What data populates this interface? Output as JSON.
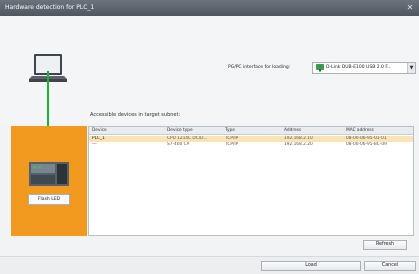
{
  "window": {
    "title": "Hardware detection for PLC_1",
    "close_glyph": "✕"
  },
  "interface": {
    "label": "PG/PC interface for loading:",
    "selected": "D-Link DUB-E100 USB 2.0 F...",
    "icon": "network-adapter-icon"
  },
  "table": {
    "caption": "Accessible devices in target subnet:",
    "headers": {
      "device": "Device",
      "device_type": "Device type",
      "type": "Type",
      "address": "Address",
      "mac": "MAC address"
    },
    "rows": [
      {
        "device": "PLC_1",
        "device_type": "CPU 1214C DC/D...",
        "type": "TCP/IP",
        "address": "192.168.2.10",
        "mac": "08-00-06-95-01-01"
      },
      {
        "device": "---",
        "device_type": "S7-400 CP",
        "type": "TCP/IP",
        "address": "192.168.2.20",
        "mac": "08-00-06-95-BC-09"
      }
    ]
  },
  "plc": {
    "flash_label": "Flash LED"
  },
  "buttons": {
    "refresh": "Refresh",
    "load": "Load",
    "cancel": "Cancel"
  },
  "colors": {
    "accent_orange": "#f19a1f",
    "link_green": "#19b43a",
    "selected_row": "#fbe3b4",
    "titlebar": "#5b636b"
  }
}
